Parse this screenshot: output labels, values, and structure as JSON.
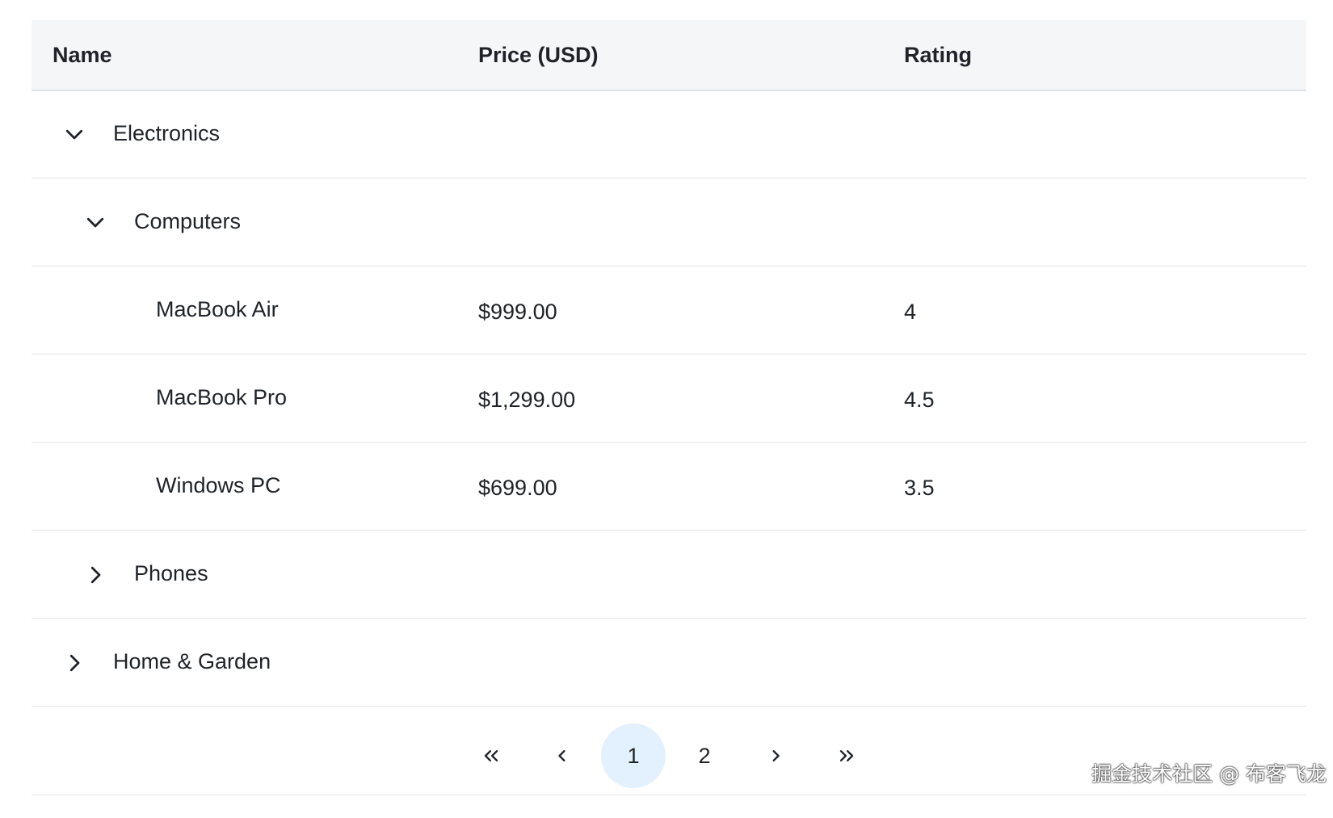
{
  "table": {
    "columns": [
      "Name",
      "Price (USD)",
      "Rating"
    ],
    "rows": [
      {
        "name": "Electronics",
        "level": 0,
        "expanded": true,
        "price": "",
        "rating": ""
      },
      {
        "name": "Computers",
        "level": 1,
        "expanded": true,
        "price": "",
        "rating": ""
      },
      {
        "name": "MacBook Air",
        "level": 2,
        "price": "$999.00",
        "rating": "4"
      },
      {
        "name": "MacBook Pro",
        "level": 2,
        "price": "$1,299.00",
        "rating": "4.5"
      },
      {
        "name": "Windows PC",
        "level": 2,
        "price": "$699.00",
        "rating": "3.5"
      },
      {
        "name": "Phones",
        "level": 1,
        "expanded": false,
        "price": "",
        "rating": ""
      },
      {
        "name": "Home & Garden",
        "level": 0,
        "expanded": false,
        "price": "",
        "rating": ""
      }
    ]
  },
  "pagination": {
    "first_icon": "double-chevron-left-icon",
    "prev_icon": "chevron-left-icon",
    "pages": [
      "1",
      "2"
    ],
    "current_page": "1",
    "next_icon": "chevron-right-icon",
    "last_icon": "double-chevron-right-icon"
  },
  "watermark": "掘金技术社区 @ 布客飞龙",
  "colors": {
    "header_bg": "#f5f6f8",
    "active_page_bg": "#e3f0fd",
    "border": "#e2e5e9"
  }
}
